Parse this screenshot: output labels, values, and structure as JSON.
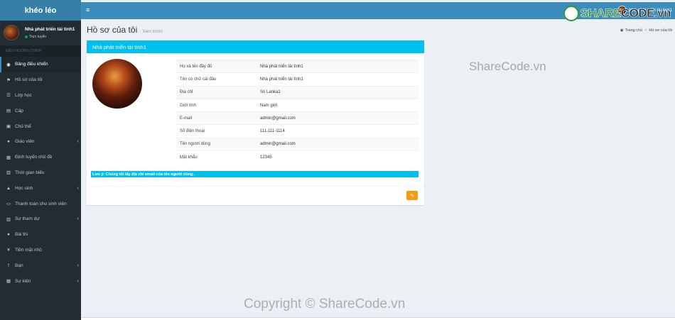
{
  "sidebar": {
    "logo": "khéo léo",
    "user_name": "Nhà phát triển tài tình1",
    "user_status": "Trực tuyến",
    "nav_header": "ĐIỀU HƯỚNG CHÍNH",
    "items": [
      {
        "label": "Bảng điều khiển",
        "icon": "dashboard-icon",
        "glyph": "◉"
      },
      {
        "label": "Hồ sơ của tôi",
        "icon": "flag-icon",
        "glyph": "⚑"
      },
      {
        "label": "Lớp học",
        "icon": "list-icon",
        "glyph": "☰"
      },
      {
        "label": "Cấp",
        "icon": "book-icon",
        "glyph": "▤"
      },
      {
        "label": "Chủ thể",
        "icon": "book-open-icon",
        "glyph": "▣"
      },
      {
        "label": "Giáo viên",
        "icon": "user-icon",
        "glyph": "●"
      },
      {
        "label": "Định tuyến chủ đề",
        "icon": "grid-icon",
        "glyph": "▦"
      },
      {
        "label": "Thời gian biểu",
        "icon": "calendar-icon",
        "glyph": "▥"
      },
      {
        "label": "Học sinh",
        "icon": "graduation-cap-icon",
        "glyph": "▲"
      },
      {
        "label": "Thanh toán cho sinh viên",
        "icon": "credit-card-icon",
        "glyph": "▭"
      },
      {
        "label": "Sự tham dự",
        "icon": "calendar-check-icon",
        "glyph": "▥"
      },
      {
        "label": "Bài thi",
        "icon": "circle-icon",
        "glyph": "●"
      },
      {
        "label": "Tiền mặt nhỏ",
        "icon": "yen-icon",
        "glyph": "¥"
      },
      {
        "label": "Bạn",
        "icon": "facebook-icon",
        "glyph": "f"
      },
      {
        "label": "Sự kiện",
        "icon": "calendar-alt-icon",
        "glyph": "▦"
      }
    ]
  },
  "topbar": {
    "user_name": "Nhà phát triển tài tình1"
  },
  "header": {
    "title": "Hồ sơ của tôi",
    "subtitle": "Xem trước",
    "breadcrumb_home": "Trang chủ",
    "breadcrumb_current": "Hồ sơ của tôi"
  },
  "profile": {
    "box_title": "Nhà phát triển tài tình1",
    "rows": [
      {
        "label": "Họ và tên đầy đủ",
        "value": "Nhà phát triển tài tình1"
      },
      {
        "label": "Tên có chữ cái đầu",
        "value": "Nhà phát triển tài tình1"
      },
      {
        "label": "Địa chỉ",
        "value": "Sri Lanka1"
      },
      {
        "label": "Giới tính",
        "value": "Nam giới"
      },
      {
        "label": "E-mail",
        "value": "admin@gmail.com"
      },
      {
        "label": "Số điện thoại",
        "value": "111-111-1114"
      },
      {
        "label": "Tên người dùng",
        "value": "admin@gmail.com"
      },
      {
        "label": "Mật khẩu",
        "value": "12345"
      }
    ],
    "note": "Lưu ý: Chúng tôi lấy địa chỉ email của tên người dùng."
  },
  "watermarks": {
    "logo_part1": "SHARE",
    "logo_part2": "CODE",
    "logo_part3": ".vn",
    "middle": "ShareCode.vn",
    "bottom": "Copyright © ShareCode.vn"
  },
  "colors": {
    "sidebar_bg": "#222d32",
    "logo_bg": "#367fa9",
    "topbar_bg": "#3c8dbc",
    "box_header": "#00c0ef",
    "edit_button": "#f39c12"
  }
}
